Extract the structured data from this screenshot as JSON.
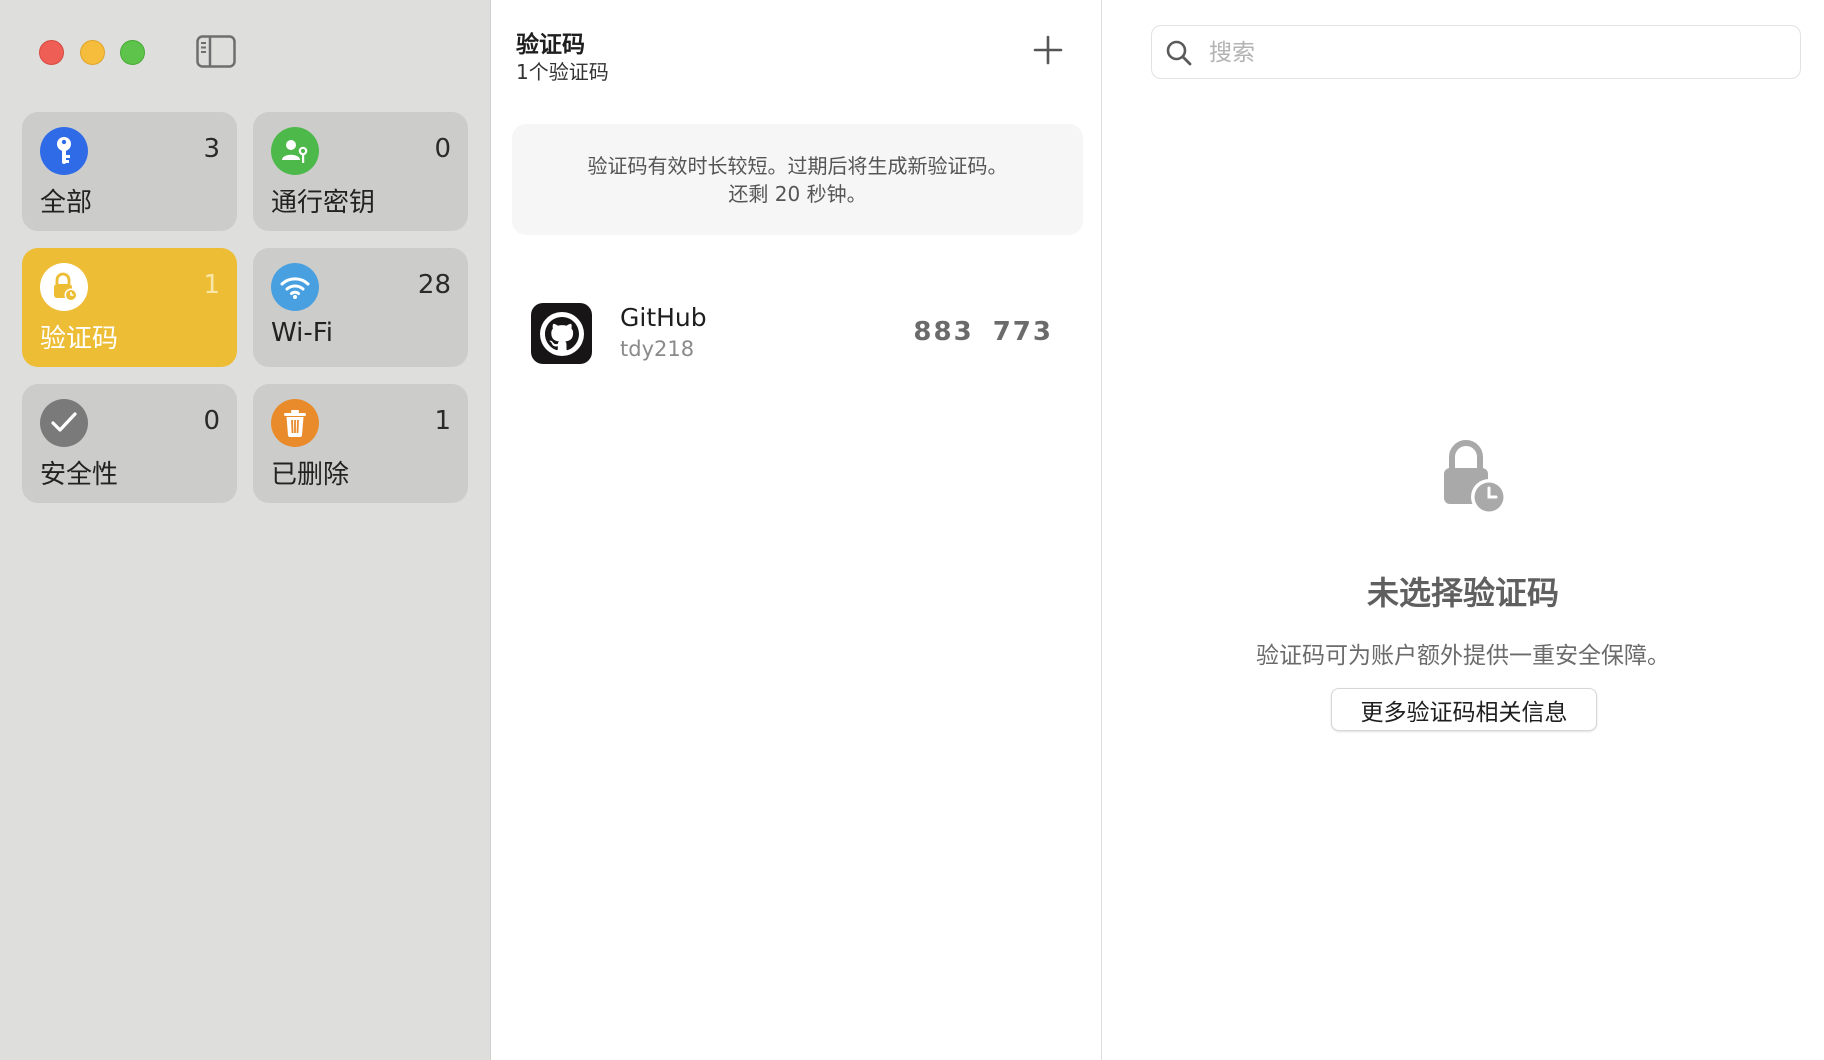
{
  "colors": {
    "sidebar_bg": "#dededd",
    "tile_bg": "#cccccb",
    "selected_tile_bg": "#ecbd35",
    "all_icon": "#2f6be7",
    "passkeys_icon": "#4cb94a",
    "wifi_icon": "#49a0e1",
    "security_icon": "#7a7a7a",
    "deleted_icon": "#e98b2b"
  },
  "window_controls": {
    "close": "close-icon",
    "minimize": "minimize-icon",
    "zoom": "zoom-icon",
    "sidebar_toggle": "sidebar-toggle-icon"
  },
  "sidebar": {
    "tiles": [
      {
        "label": "全部",
        "count": "3",
        "icon": "key-icon",
        "selected": false
      },
      {
        "label": "通行密钥",
        "count": "0",
        "icon": "passkey-icon",
        "selected": false
      },
      {
        "label": "验证码",
        "count": "1",
        "icon": "lock-clock-icon",
        "selected": true
      },
      {
        "label": "Wi-Fi",
        "count": "28",
        "icon": "wifi-icon",
        "selected": false
      },
      {
        "label": "安全性",
        "count": "0",
        "icon": "checkmark-icon",
        "selected": false
      },
      {
        "label": "已删除",
        "count": "1",
        "icon": "trash-icon",
        "selected": false
      }
    ]
  },
  "list": {
    "title": "验证码",
    "subtitle": "1个验证码",
    "add_icon": "plus-icon",
    "banner_line1": "验证码有效时长较短。过期后将生成新验证码。",
    "banner_line2": "还剩 20 秒钟。",
    "accounts": [
      {
        "name": "GitHub",
        "user": "tdy218",
        "code": "883 773",
        "logo": "github-icon"
      }
    ]
  },
  "detail": {
    "search": {
      "placeholder": "搜索",
      "value": ""
    },
    "empty_title": "未选择验证码",
    "empty_desc": "验证码可为账户额外提供一重安全保障。",
    "more_info_label": "更多验证码相关信息"
  }
}
